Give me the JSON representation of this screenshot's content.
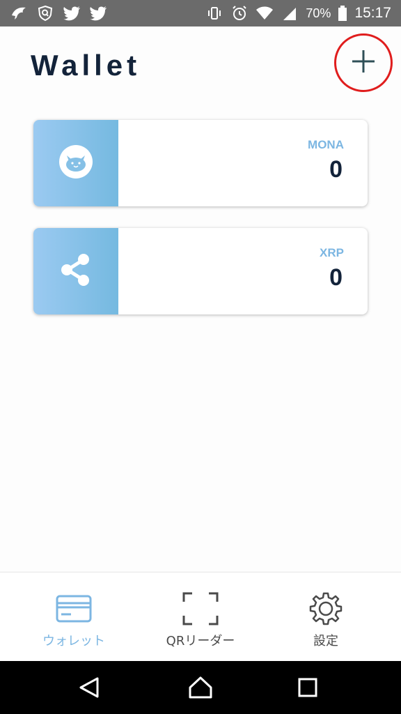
{
  "status_bar": {
    "battery": "70%",
    "time": "15:17",
    "left_icons": [
      "bird-app-icon",
      "security-shield-icon",
      "twitter-icon",
      "twitter-icon"
    ],
    "right_icons": [
      "vibrate-icon",
      "alarm-icon",
      "wifi-icon",
      "signal-icon",
      "battery-icon"
    ]
  },
  "header": {
    "title": "Wallet",
    "add_icon": "plus-icon"
  },
  "wallets": [
    {
      "symbol": "MONA",
      "balance": "0",
      "icon": "monacoin-cat-icon"
    },
    {
      "symbol": "XRP",
      "balance": "0",
      "icon": "ripple-icon"
    }
  ],
  "bottom_nav": [
    {
      "label": "ウォレット",
      "icon": "wallet-card-icon",
      "active": true
    },
    {
      "label": "QRリーダー",
      "icon": "qr-scan-icon",
      "active": false
    },
    {
      "label": "設定",
      "icon": "gear-icon",
      "active": false
    }
  ],
  "system_nav": [
    "back-icon",
    "home-icon",
    "recents-icon"
  ],
  "colors": {
    "accent": "#7cb6e2",
    "title": "#13233a",
    "highlight_circle": "#e01d1d",
    "status_bar": "#6b6b6b"
  }
}
